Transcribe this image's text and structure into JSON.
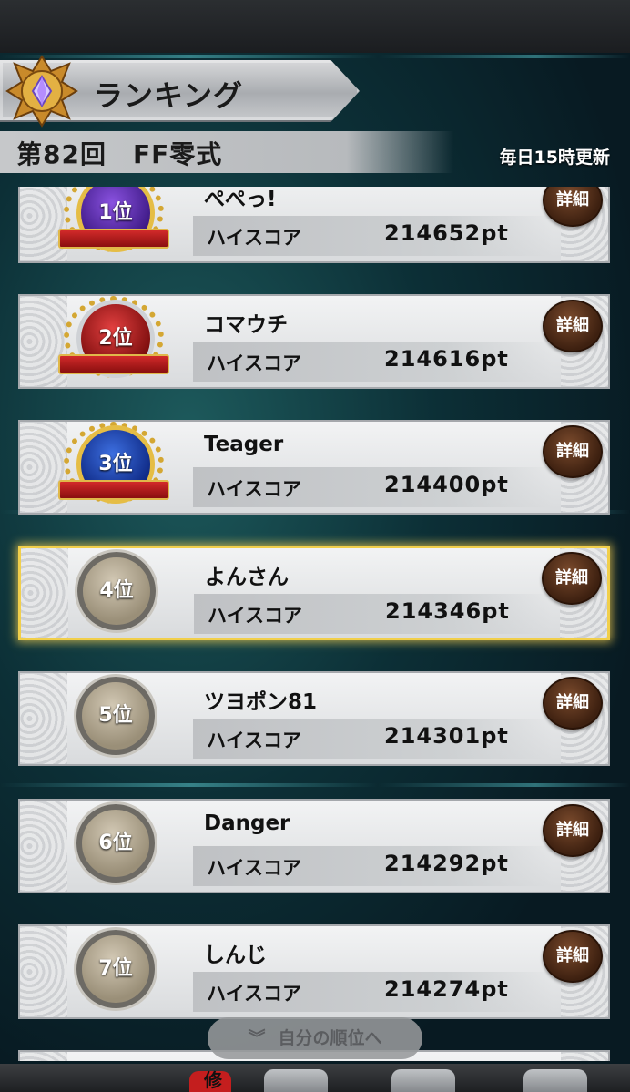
{
  "header": {
    "title": "ランキング",
    "event": "第82回　FF零式",
    "update_note": "毎日15時更新"
  },
  "entries": [
    {
      "rank_label": "1位",
      "name": "ぺぺっ!",
      "score_label": "ハイスコア",
      "score": "214652pt",
      "detail_label": "詳細",
      "medal": "gold"
    },
    {
      "rank_label": "2位",
      "name": "コマウチ",
      "score_label": "ハイスコア",
      "score": "214616pt",
      "detail_label": "詳細",
      "medal": "red"
    },
    {
      "rank_label": "3位",
      "name": "Teager",
      "score_label": "ハイスコア",
      "score": "214400pt",
      "detail_label": "詳細",
      "medal": "blue"
    },
    {
      "rank_label": "4位",
      "name": "よんさん",
      "score_label": "ハイスコア",
      "score": "214346pt",
      "detail_label": "詳細",
      "medal": "plain",
      "highlighted": true
    },
    {
      "rank_label": "5位",
      "name": "ツヨポン81",
      "score_label": "ハイスコア",
      "score": "214301pt",
      "detail_label": "詳細",
      "medal": "plain"
    },
    {
      "rank_label": "6位",
      "name": "Danger",
      "score_label": "ハイスコア",
      "score": "214292pt",
      "detail_label": "詳細",
      "medal": "plain"
    },
    {
      "rank_label": "7位",
      "name": "しんじ",
      "score_label": "ハイスコア",
      "score": "214274pt",
      "detail_label": "詳細",
      "medal": "plain"
    }
  ],
  "jump_button": {
    "chevron": "︾",
    "label": "自分の順位へ"
  },
  "bottom_nav": {
    "partial_label": "修"
  },
  "colors": {
    "highlight_border": "#f1cf4b",
    "detail_button": "#3d2010",
    "background": "#0c2f36"
  }
}
